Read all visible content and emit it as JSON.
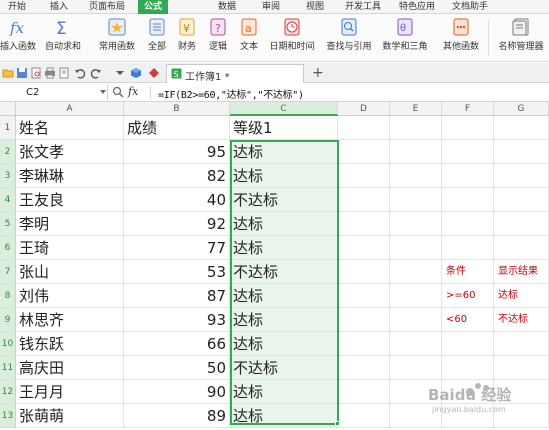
{
  "menu": {
    "tabs": [
      "开始",
      "插入",
      "页面布局",
      "公式",
      "数据",
      "审阅",
      "视图",
      "开发工具",
      "特色应用",
      "文档助手"
    ],
    "active_tab": "公式"
  },
  "ribbon": {
    "insert_function": "插入函数",
    "autosum": "自动求和",
    "common_functions": "常用函数",
    "all": "全部",
    "finance": "财务",
    "logic": "逻辑",
    "text": "文本",
    "datetime": "日期和时间",
    "lookup": "查找与引用",
    "math": "数学和三角",
    "other": "其他函数",
    "name_manager": "名称管理器"
  },
  "doc_tab": {
    "title": "工作簿1 *",
    "plus": "+"
  },
  "formula_bar": {
    "name_box": "C2",
    "fx": "fx",
    "formula": "=IF(B2>=60,\"达标\",\"不达标\")"
  },
  "columns": [
    "A",
    "B",
    "C",
    "D",
    "E",
    "F",
    "G"
  ],
  "selected_column": "C",
  "rows": [
    {
      "num": "1",
      "name": "姓名",
      "score": "成绩",
      "grade": "等级1",
      "f": "",
      "g": ""
    },
    {
      "num": "2",
      "name": "张文孝",
      "score": "95",
      "grade": "达标",
      "f": "",
      "g": ""
    },
    {
      "num": "3",
      "name": "李琳琳",
      "score": "82",
      "grade": "达标",
      "f": "",
      "g": ""
    },
    {
      "num": "4",
      "name": "王友良",
      "score": "40",
      "grade": "不达标",
      "f": "",
      "g": ""
    },
    {
      "num": "5",
      "name": "李明",
      "score": "92",
      "grade": "达标",
      "f": "",
      "g": ""
    },
    {
      "num": "6",
      "name": "王琦",
      "score": "77",
      "grade": "达标",
      "f": "",
      "g": ""
    },
    {
      "num": "7",
      "name": "张山",
      "score": "53",
      "grade": "不达标",
      "f": "条件",
      "g": "显示结果"
    },
    {
      "num": "8",
      "name": "刘伟",
      "score": "87",
      "grade": "达标",
      "f": ">=60",
      "g": "达标"
    },
    {
      "num": "9",
      "name": "林思齐",
      "score": "93",
      "grade": "达标",
      "f": "<60",
      "g": "不达标"
    },
    {
      "num": "10",
      "name": "钱东跃",
      "score": "66",
      "grade": "达标",
      "f": "",
      "g": ""
    },
    {
      "num": "11",
      "name": "高庆田",
      "score": "50",
      "grade": "不达标",
      "f": "",
      "g": ""
    },
    {
      "num": "12",
      "name": "王月月",
      "score": "90",
      "grade": "达标",
      "f": "",
      "g": ""
    },
    {
      "num": "13",
      "name": "张萌萌",
      "score": "89",
      "grade": "达标",
      "f": "",
      "g": ""
    }
  ],
  "watermark": {
    "text": "Baidu 经验",
    "sub": "jingyan.baidu.com"
  },
  "colors": {
    "accent": "#35a853",
    "annotation": "#c0000d"
  }
}
